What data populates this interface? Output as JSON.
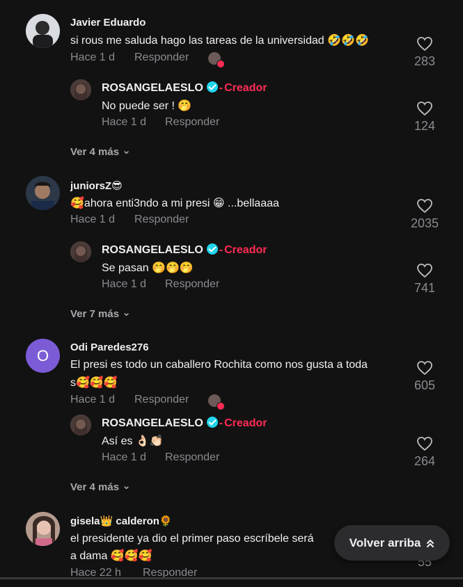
{
  "comments": [
    {
      "username": "Javier Eduardo",
      "text": "si rous me saluda hago las tareas de la universidad 🤣🤣🤣",
      "time": "Hace 1 d",
      "reply_label": "Responder",
      "likes": "283",
      "reply": {
        "username": "ROSANGELAESLO",
        "creator_label": "Creador",
        "text": "No puede ser ! 🤭",
        "time": "Hace 1 d",
        "reply_label": "Responder",
        "likes": "124"
      },
      "more": "Ver 4 más"
    },
    {
      "username": "juniorsZ😎",
      "text": "🥰ahora enti3ndo a mi presi 😁 ...bellaaaa",
      "time": "Hace 1 d",
      "reply_label": "Responder",
      "likes": "2035",
      "reply": {
        "username": "ROSANGELAESLO",
        "creator_label": "Creador",
        "text": "Se pasan 🤭🤭🤭",
        "time": "Hace 1 d",
        "reply_label": "Responder",
        "likes": "741"
      },
      "more": "Ver 7 más"
    },
    {
      "username": "Odi Paredes276",
      "avatar_letter": "O",
      "text_line1": "El presi es todo un caballero Rochita como nos gusta a toda",
      "text_line2": "s🥰🥰🥰",
      "time": "Hace 1 d",
      "reply_label": "Responder",
      "likes": "605",
      "reply": {
        "username": "ROSANGELAESLO",
        "creator_label": "Creador",
        "text": "Así es 👌🏻👏🏻",
        "time": "Hace 1 d",
        "reply_label": "Responder",
        "likes": "264"
      },
      "more": "Ver 4 más"
    },
    {
      "username": "gisela👑 calderon🌻",
      "text_line1": "el presidente ya dio el primer paso escríbele será",
      "text_line2": "a dama 🥰🥰🥰",
      "time": "Hace 22 h",
      "reply_label": "Responder",
      "likes": "55"
    }
  ],
  "back_to_top": "Volver arriba",
  "colors": {
    "background": "#121212",
    "creator": "#fe2c55",
    "verified": "#20d5ec",
    "muted": "#8a8b91"
  }
}
